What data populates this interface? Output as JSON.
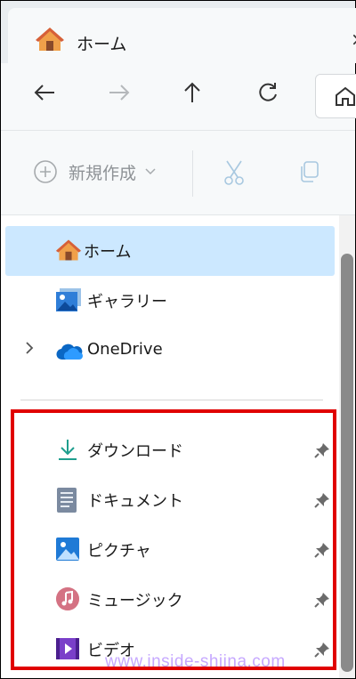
{
  "tab": {
    "title": "ホーム",
    "close_glyph": "×",
    "icon": "home-icon"
  },
  "nav": {
    "back_icon": "arrow-left-icon",
    "forward_icon": "arrow-right-icon",
    "up_icon": "arrow-up-icon",
    "refresh_icon": "refresh-icon"
  },
  "toolbar": {
    "new_label": "新規作成",
    "cut_icon": "scissors-icon",
    "copy_icon": "copy-icon"
  },
  "sidebar": {
    "top_items": [
      {
        "label": "ホーム",
        "icon": "home-icon",
        "selected": true
      },
      {
        "label": "ギャラリー",
        "icon": "gallery-icon",
        "selected": false
      },
      {
        "label": "OneDrive",
        "icon": "cloud-icon",
        "selected": false,
        "expandable": true
      }
    ],
    "pinned_items": [
      {
        "label": "ダウンロード",
        "icon": "download-icon",
        "pinned": true
      },
      {
        "label": "ドキュメント",
        "icon": "document-icon",
        "pinned": true
      },
      {
        "label": "ピクチャ",
        "icon": "picture-icon",
        "pinned": true
      },
      {
        "label": "ミュージック",
        "icon": "music-icon",
        "pinned": true
      },
      {
        "label": "ビデオ",
        "icon": "video-icon",
        "pinned": true
      }
    ]
  },
  "watermark": "www.inside-shiina.com",
  "colors": {
    "selection": "#cce8ff",
    "highlight_box": "#e00000",
    "accent": "#0078d4"
  }
}
